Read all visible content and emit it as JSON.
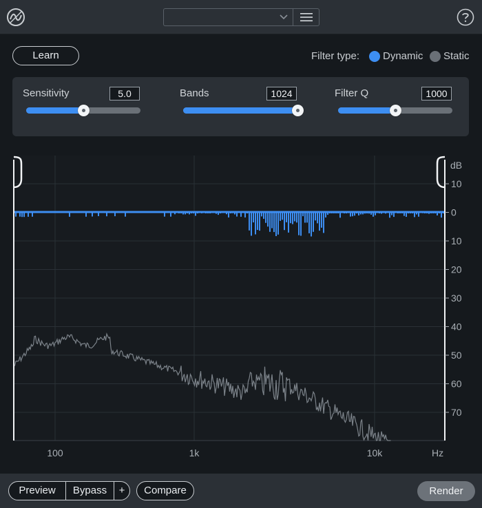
{
  "header": {
    "preset_value": "",
    "icons": {
      "logo": "tone-logo-icon",
      "menu": "hamburger-icon",
      "help": "help-icon",
      "dropdown": "chevron-down-icon"
    }
  },
  "controls": {
    "learn_label": "Learn",
    "filter_type": {
      "label": "Filter type:",
      "options": [
        "Dynamic",
        "Static"
      ],
      "selected": "Dynamic"
    },
    "sensitivity": {
      "label": "Sensitivity",
      "value": "5.0",
      "fraction": 0.5
    },
    "bands": {
      "label": "Bands",
      "value": "1024",
      "fraction": 1.0
    },
    "filter_q": {
      "label": "Filter Q",
      "value": "1000",
      "fraction": 0.5
    }
  },
  "graph": {
    "db_unit": "dB",
    "db_ticks": [
      "10",
      "0",
      "10",
      "20",
      "30",
      "40",
      "50",
      "60",
      "70"
    ],
    "hz_ticks": [
      "100",
      "1k",
      "10k"
    ],
    "hz_unit": "Hz"
  },
  "footer": {
    "preview_label": "Preview",
    "bypass_label": "Bypass",
    "plus_label": "+",
    "compare_label": "Compare",
    "render_label": "Render"
  },
  "colors": {
    "accent": "#3d8ef2",
    "background": "#15191d",
    "panel": "#2b3036",
    "spectrum": "#7c838a"
  }
}
